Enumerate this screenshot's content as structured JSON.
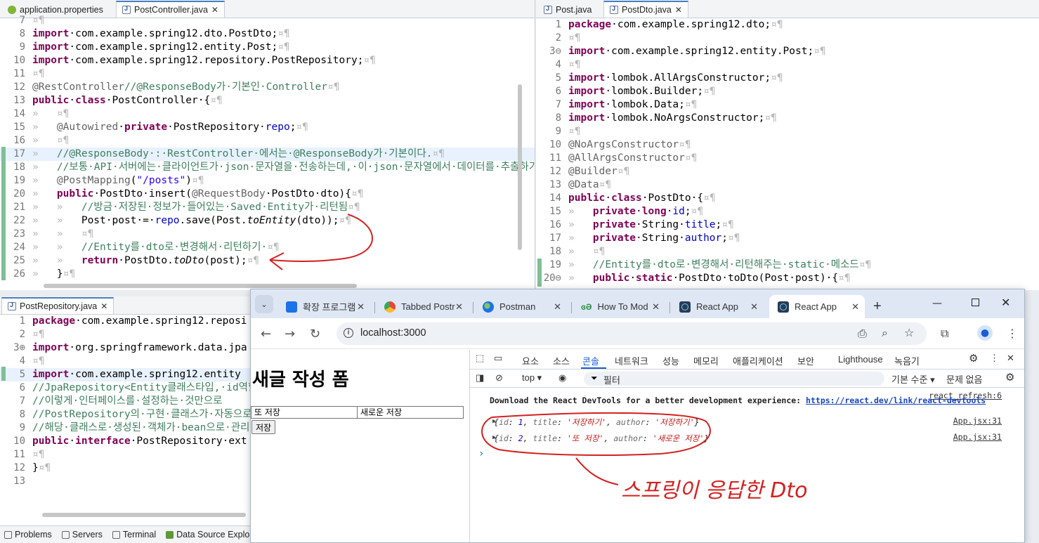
{
  "left_editor": {
    "tabs": [
      {
        "label": "application.properties",
        "active": false
      },
      {
        "label": "PostController.java",
        "active": true
      }
    ],
    "lines": [
      {
        "n": "7",
        "segs": [
          {
            "t": "¤¶",
            "c": "ws"
          }
        ]
      },
      {
        "n": "8",
        "segs": [
          {
            "t": "import",
            "c": "kw"
          },
          {
            "t": "·com.example.spring12.dto.PostDto;"
          },
          {
            "t": "¤¶",
            "c": "ws"
          }
        ]
      },
      {
        "n": "9",
        "segs": [
          {
            "t": "import",
            "c": "kw"
          },
          {
            "t": "·com.example.spring12.entity.Post;"
          },
          {
            "t": "¤¶",
            "c": "ws"
          }
        ]
      },
      {
        "n": "10",
        "segs": [
          {
            "t": "import",
            "c": "kw"
          },
          {
            "t": "·com.example.spring12.repository.PostRepository;"
          },
          {
            "t": "¤¶",
            "c": "ws"
          }
        ]
      },
      {
        "n": "11",
        "segs": [
          {
            "t": "¤¶",
            "c": "ws"
          }
        ]
      },
      {
        "n": "12",
        "segs": [
          {
            "t": "@RestController",
            "c": "ann"
          },
          {
            "t": "//@ResponseBody가·기본인·Controller",
            "c": "cm"
          },
          {
            "t": "¤¶",
            "c": "ws"
          }
        ]
      },
      {
        "n": "13",
        "segs": [
          {
            "t": "public",
            "c": "kw"
          },
          {
            "t": "·"
          },
          {
            "t": "class",
            "c": "kw"
          },
          {
            "t": "·PostController·{"
          },
          {
            "t": "¤¶",
            "c": "ws"
          }
        ]
      },
      {
        "n": "14",
        "segs": [
          {
            "t": "»   ¤¶",
            "c": "ws"
          }
        ]
      },
      {
        "n": "15",
        "segs": [
          {
            "t": "»   ",
            "c": "ws"
          },
          {
            "t": "@Autowired",
            "c": "ann"
          },
          {
            "t": "·"
          },
          {
            "t": "private",
            "c": "kw"
          },
          {
            "t": "·PostRepository·"
          },
          {
            "t": "repo",
            "c": "fld"
          },
          {
            "t": ";"
          },
          {
            "t": "¤¶",
            "c": "ws"
          }
        ]
      },
      {
        "n": "16",
        "segs": [
          {
            "t": "»   ¤¶",
            "c": "ws"
          }
        ]
      },
      {
        "n": "17",
        "hl": true,
        "segs": [
          {
            "t": "»   ",
            "c": "ws"
          },
          {
            "t": "//@ResponseBody·:·RestController·에서는·@ResponseBody가·기본이다.",
            "c": "cm"
          },
          {
            "t": "¤¶",
            "c": "ws"
          }
        ]
      },
      {
        "n": "18",
        "segs": [
          {
            "t": "»   ",
            "c": "ws"
          },
          {
            "t": "//보통·API·서버에는·클라이언트가·json·문자열을·전송하는데,·이·json·문자열에서·데이터를·추출하기",
            "c": "cm"
          }
        ]
      },
      {
        "n": "19",
        "segs": [
          {
            "t": "»   ",
            "c": "ws"
          },
          {
            "t": "@PostMapping",
            "c": "ann"
          },
          {
            "t": "("
          },
          {
            "t": "\"/posts\"",
            "c": "str"
          },
          {
            "t": ")"
          },
          {
            "t": "¤¶",
            "c": "ws"
          }
        ]
      },
      {
        "n": "20",
        "segs": [
          {
            "t": "»   ",
            "c": "ws"
          },
          {
            "t": "public",
            "c": "kw"
          },
          {
            "t": "·PostDto·insert("
          },
          {
            "t": "@RequestBody",
            "c": "ann"
          },
          {
            "t": "·PostDto·dto){"
          },
          {
            "t": "¤¶",
            "c": "ws"
          }
        ]
      },
      {
        "n": "21",
        "segs": [
          {
            "t": "»   »   ",
            "c": "ws"
          },
          {
            "t": "//방금·저장된·정보가·들어있는·Saved·Entity가·리턴됨",
            "c": "cm"
          },
          {
            "t": "¤¶",
            "c": "ws"
          }
        ]
      },
      {
        "n": "22",
        "segs": [
          {
            "t": "»   »   ",
            "c": "ws"
          },
          {
            "t": "Post·post·=·"
          },
          {
            "t": "repo",
            "c": "fld"
          },
          {
            "t": ".save(Post."
          },
          {
            "t": "toEntity",
            "c": "it"
          },
          {
            "t": "(dto));"
          },
          {
            "t": "¤¶",
            "c": "ws"
          }
        ]
      },
      {
        "n": "23",
        "segs": [
          {
            "t": "»   »   ¤¶",
            "c": "ws"
          }
        ]
      },
      {
        "n": "24",
        "segs": [
          {
            "t": "»   »   ",
            "c": "ws"
          },
          {
            "t": "//Entity를·dto로·변경해서·리턴하기·",
            "c": "cm"
          },
          {
            "t": "¤¶",
            "c": "ws"
          }
        ]
      },
      {
        "n": "25",
        "segs": [
          {
            "t": "»   »   ",
            "c": "ws"
          },
          {
            "t": "return",
            "c": "kw"
          },
          {
            "t": "·PostDto."
          },
          {
            "t": "toDto",
            "c": "it"
          },
          {
            "t": "(post);"
          },
          {
            "t": "¤¶",
            "c": "ws"
          }
        ]
      },
      {
        "n": "26",
        "segs": [
          {
            "t": "»   ",
            "c": "ws"
          },
          {
            "t": "}"
          },
          {
            "t": "¤¶",
            "c": "ws"
          }
        ]
      }
    ]
  },
  "right_editor": {
    "tabs": [
      {
        "label": "Post.java",
        "active": false
      },
      {
        "label": "PostDto.java",
        "active": true
      }
    ],
    "lines": [
      {
        "n": "1",
        "segs": [
          {
            "t": "package",
            "c": "kw"
          },
          {
            "t": "·com.example.spring12.dto;"
          },
          {
            "t": "¤¶",
            "c": "ws"
          }
        ]
      },
      {
        "n": "2",
        "segs": [
          {
            "t": "¤¶",
            "c": "ws"
          }
        ]
      },
      {
        "n": "3⊖",
        "segs": [
          {
            "t": "import",
            "c": "kw"
          },
          {
            "t": "·com.example.spring12.entity.Post;"
          },
          {
            "t": "¤¶",
            "c": "ws"
          }
        ]
      },
      {
        "n": "4",
        "segs": [
          {
            "t": "¤¶",
            "c": "ws"
          }
        ]
      },
      {
        "n": "5",
        "segs": [
          {
            "t": "import",
            "c": "kw"
          },
          {
            "t": "·lombok.AllArgsConstructor;"
          },
          {
            "t": "¤¶",
            "c": "ws"
          }
        ]
      },
      {
        "n": "6",
        "segs": [
          {
            "t": "import",
            "c": "kw"
          },
          {
            "t": "·lombok.Builder;"
          },
          {
            "t": "¤¶",
            "c": "ws"
          }
        ]
      },
      {
        "n": "7",
        "segs": [
          {
            "t": "import",
            "c": "kw"
          },
          {
            "t": "·lombok.Data;"
          },
          {
            "t": "¤¶",
            "c": "ws"
          }
        ]
      },
      {
        "n": "8",
        "segs": [
          {
            "t": "import",
            "c": "kw"
          },
          {
            "t": "·lombok.NoArgsConstructor;"
          },
          {
            "t": "¤¶",
            "c": "ws"
          }
        ]
      },
      {
        "n": "9",
        "segs": [
          {
            "t": "¤¶",
            "c": "ws"
          }
        ]
      },
      {
        "n": "10",
        "segs": [
          {
            "t": "@NoArgsConstructor",
            "c": "ann"
          },
          {
            "t": "¤¶",
            "c": "ws"
          }
        ]
      },
      {
        "n": "11",
        "segs": [
          {
            "t": "@AllArgsConstructor",
            "c": "ann"
          },
          {
            "t": "¤¶",
            "c": "ws"
          }
        ]
      },
      {
        "n": "12",
        "segs": [
          {
            "t": "@Builder",
            "c": "ann"
          },
          {
            "t": "¤¶",
            "c": "ws"
          }
        ]
      },
      {
        "n": "13",
        "segs": [
          {
            "t": "@Data",
            "c": "ann"
          },
          {
            "t": "¤¶",
            "c": "ws"
          }
        ]
      },
      {
        "n": "14",
        "segs": [
          {
            "t": "public",
            "c": "kw"
          },
          {
            "t": "·"
          },
          {
            "t": "class",
            "c": "kw"
          },
          {
            "t": "·PostDto·{"
          },
          {
            "t": "¤¶",
            "c": "ws"
          }
        ]
      },
      {
        "n": "15",
        "segs": [
          {
            "t": "»   ",
            "c": "ws"
          },
          {
            "t": "private",
            "c": "kw"
          },
          {
            "t": "·"
          },
          {
            "t": "long",
            "c": "kw"
          },
          {
            "t": "·"
          },
          {
            "t": "id",
            "c": "fld"
          },
          {
            "t": ";"
          },
          {
            "t": "¤¶",
            "c": "ws"
          }
        ]
      },
      {
        "n": "16",
        "segs": [
          {
            "t": "»   ",
            "c": "ws"
          },
          {
            "t": "private",
            "c": "kw"
          },
          {
            "t": "·String·"
          },
          {
            "t": "title",
            "c": "fld"
          },
          {
            "t": ";"
          },
          {
            "t": "¤¶",
            "c": "ws"
          }
        ]
      },
      {
        "n": "17",
        "segs": [
          {
            "t": "»   ",
            "c": "ws"
          },
          {
            "t": "private",
            "c": "kw"
          },
          {
            "t": "·String·"
          },
          {
            "t": "author",
            "c": "fld"
          },
          {
            "t": ";"
          },
          {
            "t": "¤¶",
            "c": "ws"
          }
        ]
      },
      {
        "n": "18",
        "segs": [
          {
            "t": "»   ¤¶",
            "c": "ws"
          }
        ]
      },
      {
        "n": "19",
        "segs": [
          {
            "t": "»   ",
            "c": "ws"
          },
          {
            "t": "//Entity를·dto로·변경해서·리턴해주는·static·메소드",
            "c": "cm"
          },
          {
            "t": "¤¶",
            "c": "ws"
          }
        ]
      },
      {
        "n": "20⊖",
        "segs": [
          {
            "t": "»   ",
            "c": "ws"
          },
          {
            "t": "public",
            "c": "kw"
          },
          {
            "t": "·"
          },
          {
            "t": "static",
            "c": "kw"
          },
          {
            "t": "·PostDto·toDto(Post·post)·{"
          },
          {
            "t": "¤¶",
            "c": "ws"
          }
        ]
      }
    ]
  },
  "bottom_editor": {
    "tabs": [
      {
        "label": "PostRepository.java",
        "active": true
      }
    ],
    "lines": [
      {
        "n": "1",
        "segs": [
          {
            "t": "package",
            "c": "kw"
          },
          {
            "t": "·com.example.spring12.reposi"
          }
        ]
      },
      {
        "n": "2",
        "segs": [
          {
            "t": "¤¶",
            "c": "ws"
          }
        ]
      },
      {
        "n": "3⊕",
        "segs": [
          {
            "t": "import",
            "c": "kw"
          },
          {
            "t": "·org.springframework.data.jpa"
          }
        ]
      },
      {
        "n": "4",
        "segs": [
          {
            "t": "¤¶",
            "c": "ws"
          }
        ]
      },
      {
        "n": "5",
        "hl": true,
        "segs": [
          {
            "t": "import",
            "c": "kw"
          },
          {
            "t": "·com.example.spring12.entity"
          }
        ]
      },
      {
        "n": "6",
        "segs": [
          {
            "t": "//JpaRepository<Entity클래스타입,·id역할",
            "c": "cm"
          }
        ]
      },
      {
        "n": "7",
        "segs": [
          {
            "t": "//이렇게·인터페이스를·설정하는·것만으로",
            "c": "cm"
          }
        ]
      },
      {
        "n": "8",
        "segs": [
          {
            "t": "//PostRepository의·구현·클래스가·자동으로",
            "c": "cm"
          }
        ]
      },
      {
        "n": "9",
        "segs": [
          {
            "t": "//해당·클래스로·생성된·객체가·bean으로·관리된다",
            "c": "cm"
          }
        ]
      },
      {
        "n": "10",
        "segs": [
          {
            "t": "public",
            "c": "kw"
          },
          {
            "t": "·"
          },
          {
            "t": "interface",
            "c": "kw"
          },
          {
            "t": "·PostRepository·ext"
          }
        ]
      },
      {
        "n": "11",
        "segs": [
          {
            "t": "¤¶",
            "c": "ws"
          }
        ]
      },
      {
        "n": "12",
        "segs": [
          {
            "t": "}"
          },
          {
            "t": "¤¶",
            "c": "ws"
          }
        ]
      },
      {
        "n": "13",
        "segs": []
      }
    ]
  },
  "status_tabs": [
    {
      "label": "Problems",
      "icon": "problems-icon"
    },
    {
      "label": "Servers",
      "icon": "servers-icon"
    },
    {
      "label": "Terminal",
      "icon": "terminal-icon"
    },
    {
      "label": "Data Source Explore",
      "icon": "data-source-icon"
    }
  ],
  "browser": {
    "tabs": [
      {
        "label": "확장 프로그램",
        "icon": "puzzle-icon",
        "color": "#1a73e8"
      },
      {
        "label": "Tabbed Postr",
        "icon": "chrome-icon",
        "color": "#e8453c"
      },
      {
        "label": "Postman",
        "icon": "globe-icon",
        "color": "#1a73e8"
      },
      {
        "label": "How To Mod",
        "icon": "geeks-icon",
        "color": "#2f8d46"
      },
      {
        "label": "React App",
        "icon": "react-icon",
        "color": "#2b3a55"
      },
      {
        "label": "React App",
        "icon": "react-icon",
        "color": "#2b3a55",
        "active": true
      }
    ],
    "new_tab": "+",
    "url": "localhost:3000",
    "page": {
      "title": "새글 작성 폼",
      "title_value": "또 저장",
      "author_value": "새로운 저장",
      "save_label": "저장"
    },
    "devtools": {
      "tabs": [
        "요소",
        "소스",
        "콘솔",
        "네트워크",
        "성능",
        "메모리",
        "애플리케이션",
        "보안",
        "Lighthouse",
        "녹음기"
      ],
      "active_tab": "콘솔",
      "context": "top ▾",
      "filter": "필터",
      "level": "기본 수준 ▾",
      "issues": "문제 없음",
      "messages": {
        "src0": "react_refresh:6",
        "devtools_text": "Download the React DevTools for a better development experience: ",
        "devtools_link": "https://react.dev/link/react-devtools",
        "log1": {
          "src": "App.jsx:31",
          "id": "1",
          "title": "'저장하기'",
          "author": "'저장하기'"
        },
        "log2": {
          "src": "App.jsx:31",
          "id": "2",
          "title": "'또 저장'",
          "author": "'새로운 저장'"
        }
      },
      "prompt": "›"
    }
  },
  "annotation": {
    "handwriting": "스프링이 응답한 Dto",
    "color": "#d42020"
  }
}
